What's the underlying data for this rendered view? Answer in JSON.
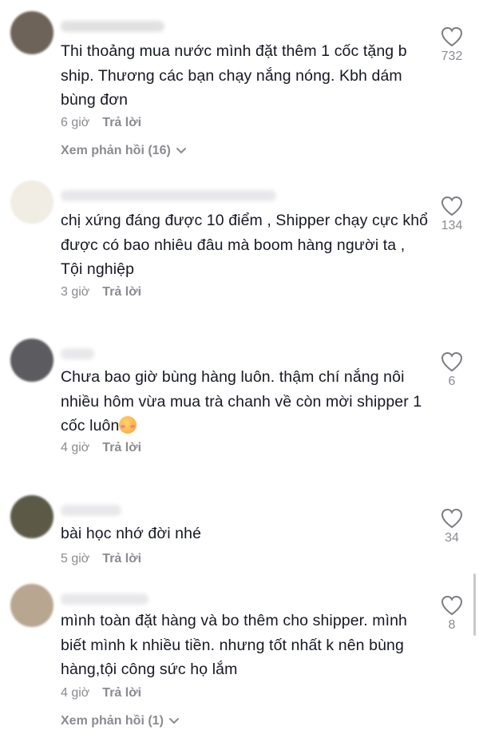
{
  "comments": [
    {
      "text": "Thi thoảng mua nước mình đặt thêm 1 cốc tặng b ship. Thương các bạn chạy nắng nóng. Kbh dám bùng đơn",
      "time": "6 giờ",
      "reply": "Trả lời",
      "likes": "732",
      "view_replies": "Xem phản hồi (16)",
      "avatar_color": "#6e6358"
    },
    {
      "text": "chị xứng đáng được 10 điểm , Shipper chạy cực khổ được có bao nhiêu đâu mà boom hàng người ta , Tội nghiệp",
      "time": "3 giờ",
      "reply": "Trả lời",
      "likes": "134",
      "avatar_color": "#f1ece4"
    },
    {
      "text": "Chưa bao giờ bùng hàng luôn. thậm chí nắng nôi nhiều hôm vừa mua trà chanh về còn mời shipper 1 cốc luôn",
      "time": "4 giờ",
      "reply": "Trả lời",
      "likes": "6",
      "emoji": "smiling-face-with-hearts",
      "avatar_color": "#5b5b60"
    },
    {
      "text": "bài học nhớ đời nhé",
      "time": "5 giờ",
      "reply": "Trả lời",
      "likes": "34",
      "avatar_color": "#5c5a47"
    },
    {
      "text": "mình toàn đặt hàng và bo thêm cho shipper. mình biết mình k nhiều tiền. nhưng tốt nhất k nên bùng hàng,tội công sức họ lắm",
      "time": "4 giờ",
      "reply": "Trả lời",
      "likes": "8",
      "view_replies": "Xem phản hồi (1)",
      "avatar_color": "#b9a690"
    }
  ],
  "icons": {
    "like": "heart-outline-icon",
    "expand": "chevron-down-icon"
  },
  "colors": {
    "text": "#161823",
    "secondary": "#8a8b91",
    "background": "#ffffff"
  }
}
